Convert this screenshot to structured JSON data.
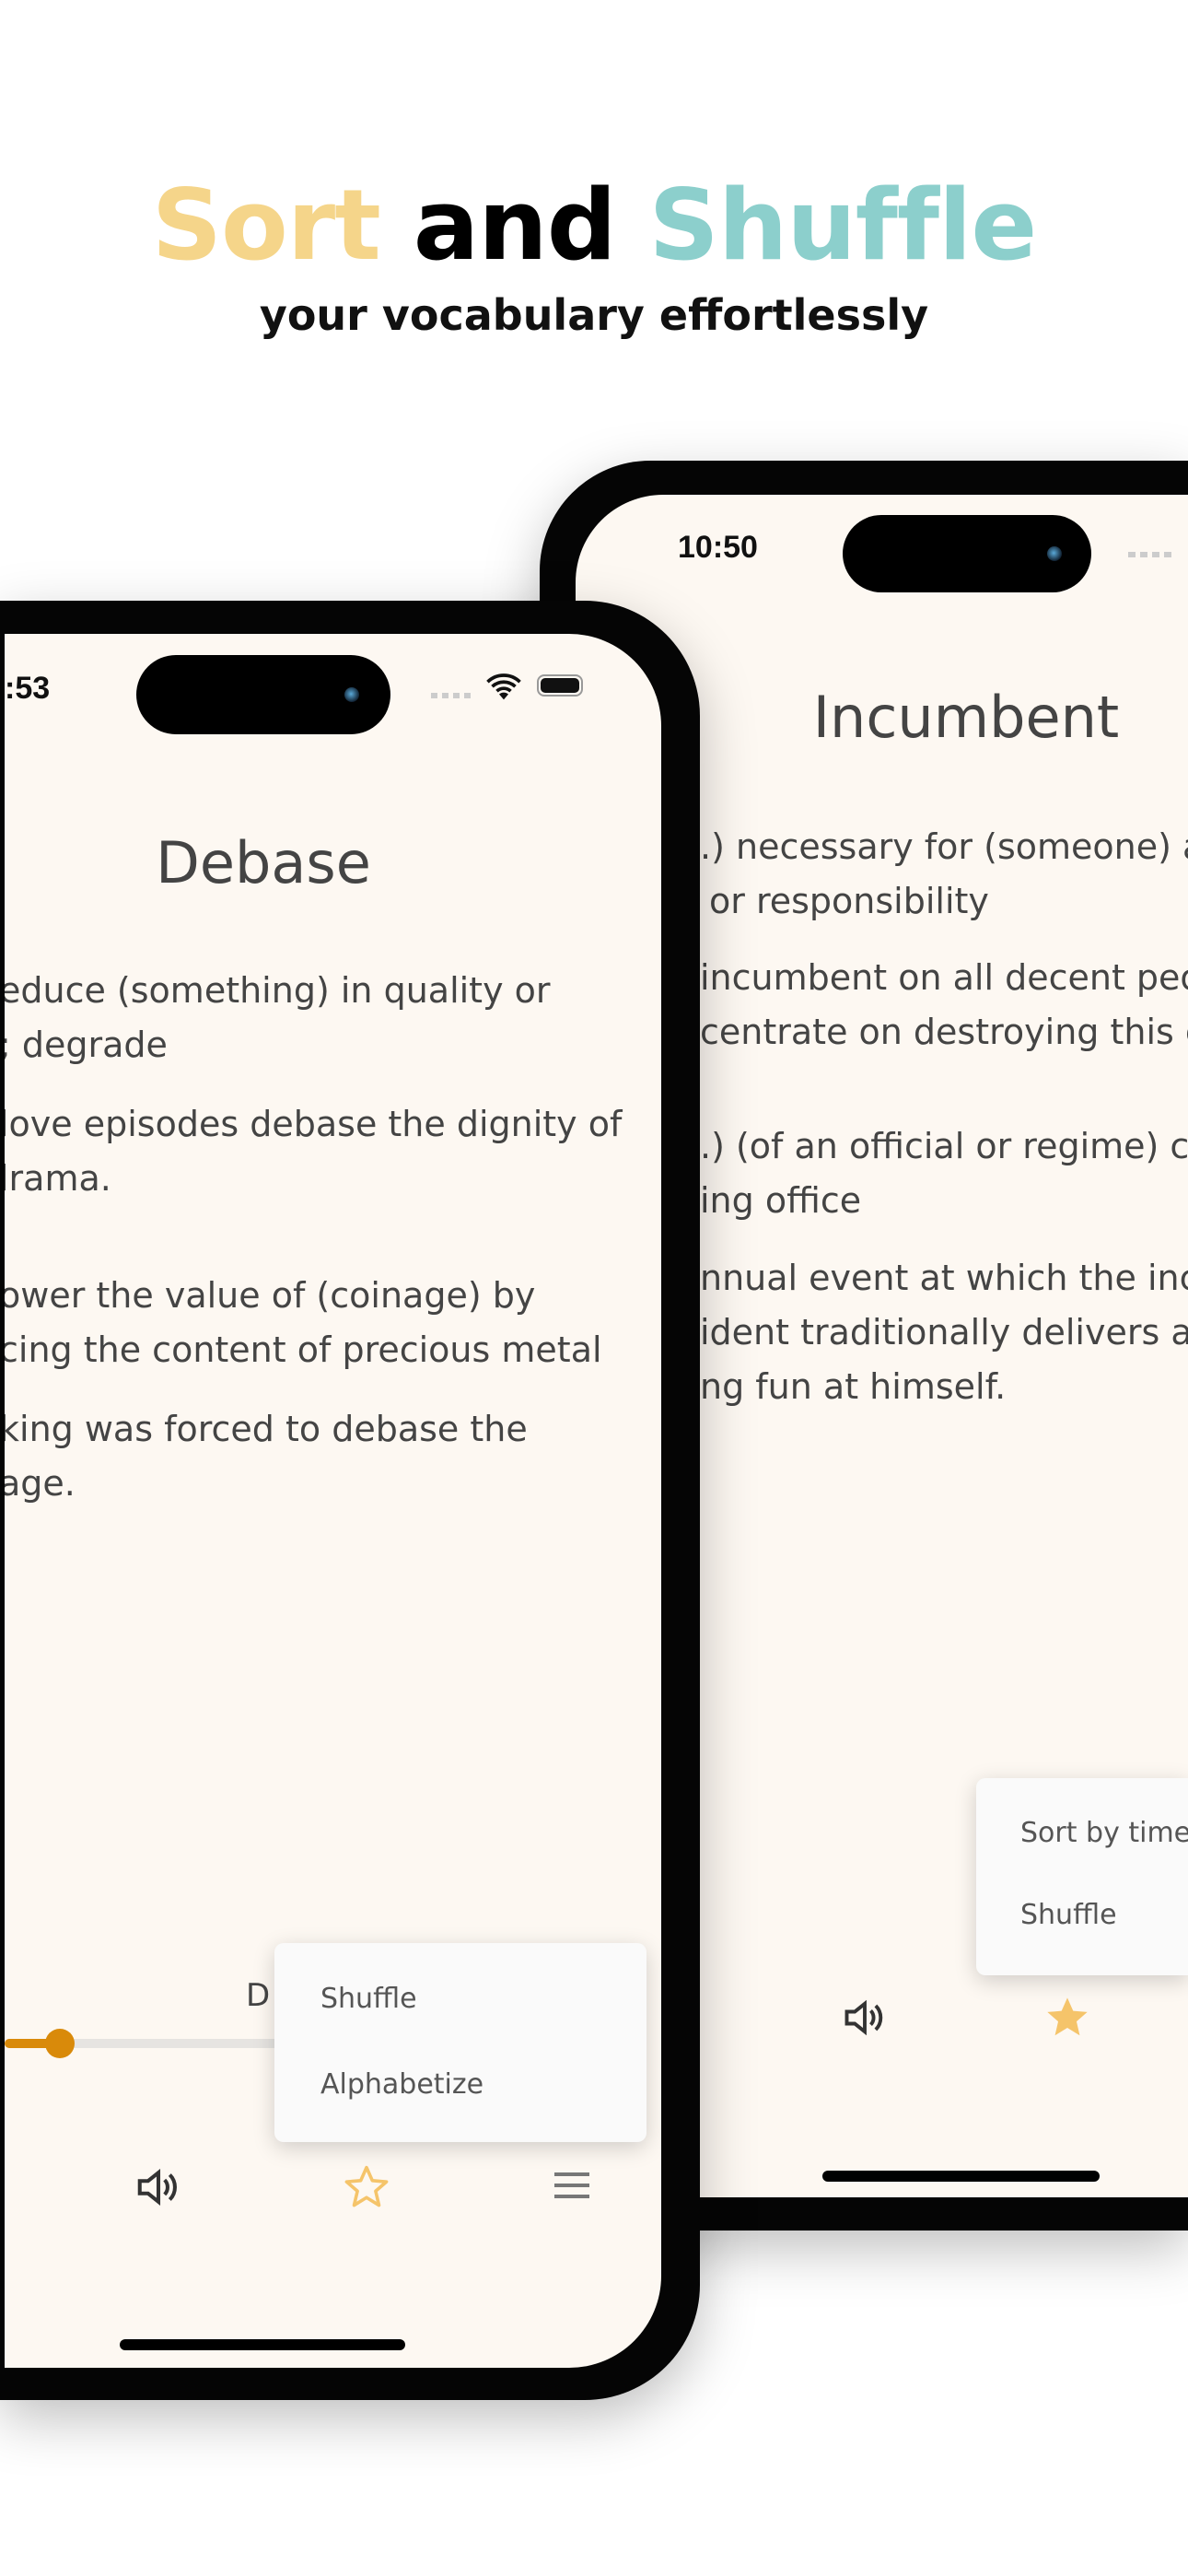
{
  "headline": {
    "word1": "Sort",
    "word2": "and",
    "word3": "Shuffle",
    "subtitle": "your vocabulary effortlessly"
  },
  "colors": {
    "sort": "#f5d58a",
    "shuffle": "#8ccfcc",
    "accent_orange": "#d98a0a",
    "star": "#f5c46a",
    "screen_bg": "#fdf8f2"
  },
  "front_phone": {
    "time": ":53",
    "word": "Debase",
    "definition_lines": [
      "educe (something) in quality or",
      "; degrade",
      "love episodes debase the dignity of",
      "lrama.",
      "ower the value of (coinage) by",
      "cing the content of precious metal",
      "king was forced to debase the",
      "age."
    ],
    "slider_label": "D",
    "slider_progress": 0.2,
    "menu": [
      "Shuffle",
      "Alphabetize"
    ],
    "toolbar_icons": [
      "speaker-icon",
      "star-outline-icon",
      "menu-icon"
    ]
  },
  "back_phone": {
    "time": "10:50",
    "word": "Incumbent",
    "definition_lines": [
      ".) necessary for (someone) as",
      "or responsibility",
      "incumbent on all decent peop",
      "centrate on destroying this evi",
      ".) (of an official or regime) cur",
      "ing office",
      "nnual event at which the incu",
      "ident traditionally delivers a s",
      "ng fun at himself."
    ],
    "menu": [
      "Sort by time",
      "Shuffle"
    ],
    "toolbar_icons": [
      "speaker-icon",
      "star-filled-icon"
    ]
  }
}
